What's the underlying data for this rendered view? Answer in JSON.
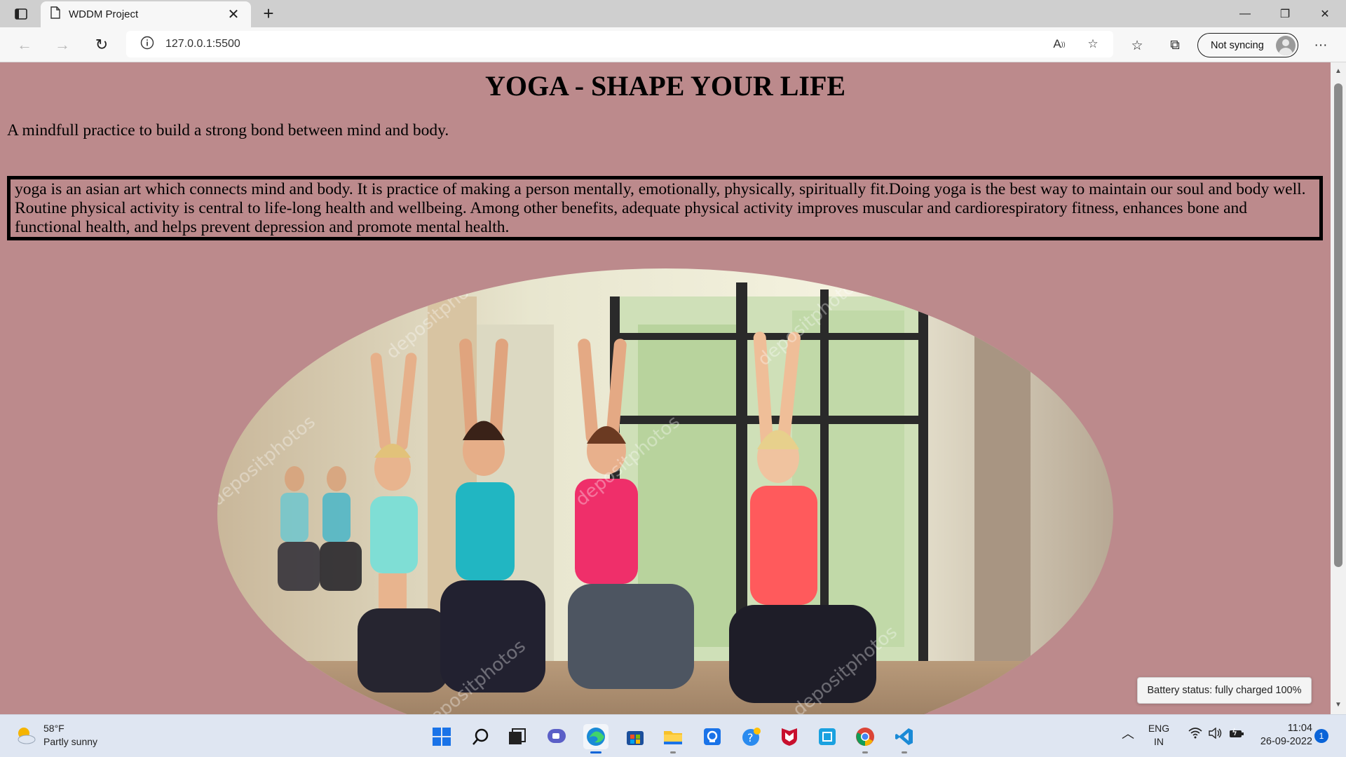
{
  "browser": {
    "tab_title": "WDDM Project",
    "url": "127.0.0.1:5500",
    "sync_label": "Not syncing"
  },
  "page": {
    "title": "YOGA - SHAPE YOUR LIFE",
    "tagline": "A mindfull practice to build a strong bond between mind and body.",
    "paragraph": "yoga is an asian art which connects mind and body. It is practice of making a person mentally, emotionally, physically, spiritually fit.Doing yoga is the best way to maintain our soul and body well. Routine physical activity is central to life-long health and wellbeing. Among other benefits, adequate physical activity improves muscular and cardiorespiratory fitness, enhances bone and functional health, and helps prevent depression and promote mental health.",
    "image_watermark": "depositphotos"
  },
  "battery_tooltip": "Battery status: fully charged 100%",
  "taskbar": {
    "weather_temp": "58°F",
    "weather_desc": "Partly sunny",
    "lang_top": "ENG",
    "lang_bottom": "IN",
    "time": "11:04",
    "date": "26-09-2022",
    "notification_count": "1"
  },
  "colors": {
    "page_background": "#bc8a8c",
    "taskbar": "#dfe6f2"
  }
}
